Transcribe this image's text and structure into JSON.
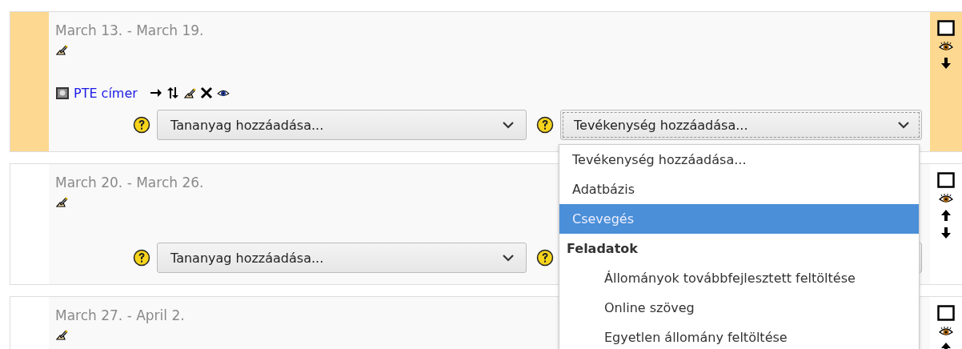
{
  "sections": [
    {
      "title": "March 13. - March 19.",
      "current": true,
      "activities": [
        {
          "label": "PTE címer",
          "tools": [
            {
              "kind": "move"
            },
            {
              "kind": "updown"
            },
            {
              "kind": "edit"
            },
            {
              "kind": "delete"
            },
            {
              "kind": "eye"
            }
          ]
        }
      ],
      "controls": [
        {
          "kind": "resource",
          "label": "Tananyag hozzáadása...",
          "focused": false
        },
        {
          "kind": "activity",
          "label": "Tevékenység hozzáadása...",
          "focused": true
        }
      ],
      "side": [
        {
          "kind": "highlight"
        },
        {
          "kind": "eye"
        },
        {
          "kind": "down"
        }
      ]
    },
    {
      "title": "March 20. - March 26.",
      "current": false,
      "controls": [
        {
          "kind": "resource",
          "label": "Tananyag hozzáadása...",
          "focused": false
        },
        {
          "kind": "activity"
        }
      ],
      "side": [
        {
          "kind": "highlight"
        },
        {
          "kind": "eye"
        },
        {
          "kind": "up"
        },
        {
          "kind": "down"
        }
      ]
    },
    {
      "title": "March 27. - April 2.",
      "current": false,
      "side": [
        {
          "kind": "highlight"
        },
        {
          "kind": "eye"
        },
        {
          "kind": "up"
        }
      ]
    }
  ],
  "open_dropdown": {
    "items": [
      {
        "kind": "option",
        "label": "Tevékenység hozzáadása...",
        "selected": false
      },
      {
        "kind": "option",
        "label": "Adatbázis",
        "selected": false
      },
      {
        "kind": "option",
        "label": "Csevegés",
        "selected": true
      },
      {
        "kind": "group",
        "label": "Feladatok",
        "children": [
          {
            "kind": "option",
            "label": "Állományok továbbfejlesztett feltöltése",
            "selected": false
          },
          {
            "kind": "option",
            "label": "Online szöveg",
            "selected": false
          },
          {
            "kind": "option",
            "label": "Egyetlen állomány feltöltése",
            "selected": false
          }
        ]
      }
    ]
  }
}
